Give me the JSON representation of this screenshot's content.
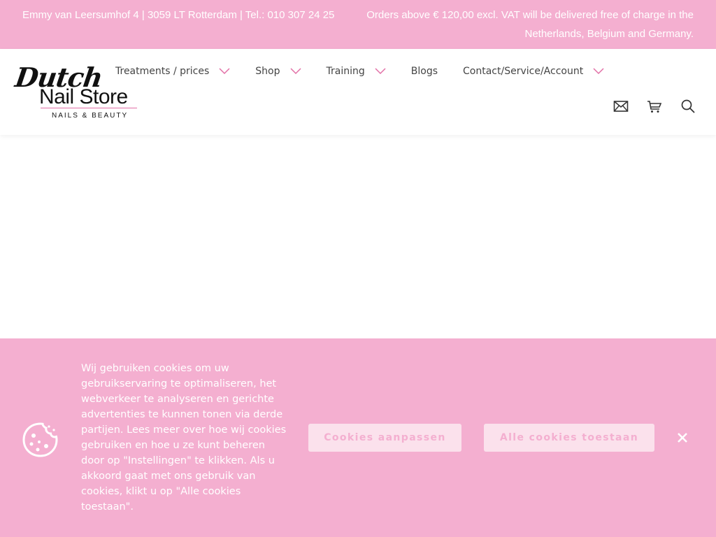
{
  "topbar": {
    "address": "Emmy van Leersumhof 4 | 3059 LT Rotterdam | Tel.: 010 307 24 25",
    "shipping_notice": "Orders above € 120,00 excl. VAT will be delivered free of charge in the Netherlands, Belgium and Germany."
  },
  "logo": {
    "script": "Dutch",
    "main": "Nail Store",
    "sub": "NAILS & BEAUTY"
  },
  "nav": {
    "items": [
      {
        "label": "Treatments / prices",
        "has_dropdown": true
      },
      {
        "label": "Shop",
        "has_dropdown": true
      },
      {
        "label": "Training",
        "has_dropdown": true
      },
      {
        "label": "Blogs",
        "has_dropdown": false
      },
      {
        "label": "Contact/Service/Account",
        "has_dropdown": true
      }
    ]
  },
  "header_icons": [
    "mail-icon",
    "cart-icon",
    "search-icon"
  ],
  "cookie_banner": {
    "text": "Wij gebruiken cookies om uw gebruikservaring te optimaliseren, het webverkeer te analyseren en gerichte advertenties te kunnen tonen via derde partijen. Lees meer over hoe wij cookies gebruiken en hoe u ze kunt beheren door op \"Instellingen\" te klikken. Als u akkoord gaat met ons gebruik van cookies, klikt u op \"Alle cookies toestaan\".",
    "customize_label": "Cookies aanpassen",
    "accept_label": "Alle cookies toestaan",
    "icon": "cookie-icon",
    "close_icon": "close-icon"
  },
  "colors": {
    "brand_pink": "#f4afd0",
    "button_bg": "#fbe1ec",
    "accent_line": "#e26fa6"
  }
}
